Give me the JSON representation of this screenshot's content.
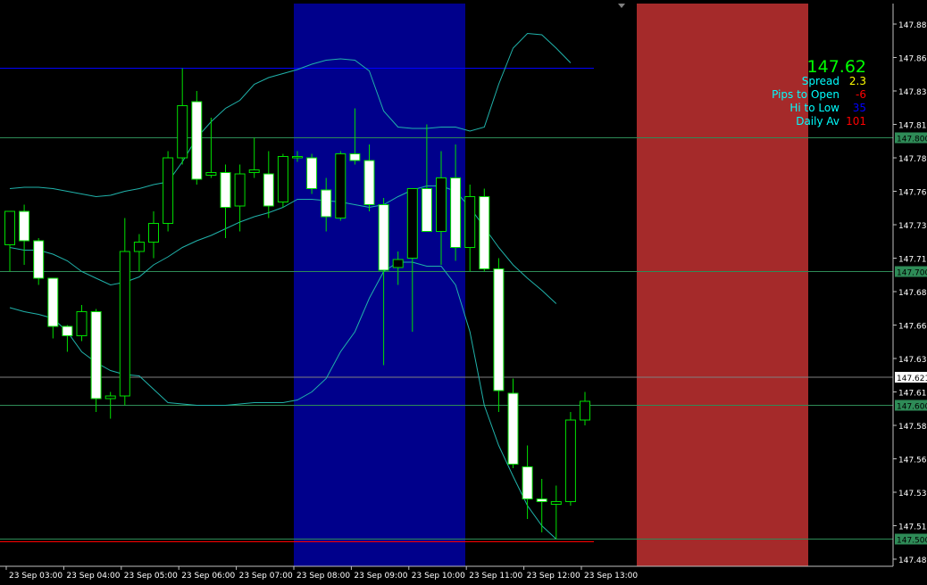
{
  "info": {
    "price": "147.62",
    "spread_label": "Spread",
    "spread_value": "2.3",
    "pips_label": "Pips to Open",
    "pips_value": "-6",
    "hilo_label": "Hi to Low",
    "hilo_value": "35",
    "daily_label": "Daily Av",
    "daily_value": "101"
  },
  "colors": {
    "background": "#000000",
    "bull_body": "#000000",
    "bear_body": "#ffffff",
    "candle_outline": "#00e000",
    "band": "#20b2aa",
    "session_blue": "#00008b",
    "session_red": "#a52a2a",
    "level_green": "#2e8b57",
    "level_blue": "#0000ff",
    "level_red": "#ff0000"
  },
  "chart_data": {
    "type": "candlestick",
    "ylim": [
      147.485,
      147.89
    ],
    "y_ticks": [
      "147.885",
      "147.860",
      "147.835",
      "147.810",
      "147.785",
      "147.760",
      "147.735",
      "147.710",
      "147.685",
      "147.660",
      "147.635",
      "147.610",
      "147.585",
      "147.560",
      "147.535",
      "147.510",
      "147.485"
    ],
    "y_tick_values": [
      147.885,
      147.86,
      147.835,
      147.81,
      147.785,
      147.76,
      147.735,
      147.71,
      147.685,
      147.66,
      147.635,
      147.61,
      147.585,
      147.56,
      147.535,
      147.51,
      147.485
    ],
    "x_tick_labels": [
      "23 Sep 03:00",
      "23 Sep 04:00",
      "23 Sep 05:00",
      "23 Sep 06:00",
      "23 Sep 07:00",
      "23 Sep 08:00",
      "23 Sep 09:00",
      "23 Sep 10:00",
      "23 Sep 11:00",
      "23 Sep 12:00",
      "23 Sep 13:00"
    ],
    "x_tick_index": [
      0,
      4,
      8,
      12,
      16,
      20,
      24,
      28,
      32,
      36,
      40
    ],
    "candles": [
      {
        "o": 147.72,
        "h": 147.74,
        "l": 147.7,
        "c": 147.745
      },
      {
        "o": 147.745,
        "h": 147.75,
        "l": 147.705,
        "c": 147.723
      },
      {
        "o": 147.723,
        "h": 147.725,
        "l": 147.69,
        "c": 147.695
      },
      {
        "o": 147.695,
        "h": 147.695,
        "l": 147.65,
        "c": 147.659
      },
      {
        "o": 147.659,
        "h": 147.66,
        "l": 147.64,
        "c": 147.652
      },
      {
        "o": 147.652,
        "h": 147.675,
        "l": 147.648,
        "c": 147.67
      },
      {
        "o": 147.67,
        "h": 147.672,
        "l": 147.595,
        "c": 147.605
      },
      {
        "o": 147.605,
        "h": 147.61,
        "l": 147.59,
        "c": 147.607
      },
      {
        "o": 147.607,
        "h": 147.74,
        "l": 147.6,
        "c": 147.715
      },
      {
        "o": 147.715,
        "h": 147.728,
        "l": 147.7,
        "c": 147.722
      },
      {
        "o": 147.722,
        "h": 147.745,
        "l": 147.71,
        "c": 147.736
      },
      {
        "o": 147.736,
        "h": 147.79,
        "l": 147.73,
        "c": 147.785
      },
      {
        "o": 147.785,
        "h": 147.852,
        "l": 147.78,
        "c": 147.824
      },
      {
        "o": 147.827,
        "h": 147.835,
        "l": 147.765,
        "c": 147.769
      },
      {
        "o": 147.772,
        "h": 147.815,
        "l": 147.77,
        "c": 147.774
      },
      {
        "o": 147.774,
        "h": 147.78,
        "l": 147.725,
        "c": 147.748
      },
      {
        "o": 147.749,
        "h": 147.78,
        "l": 147.73,
        "c": 147.773
      },
      {
        "o": 147.774,
        "h": 147.8,
        "l": 147.77,
        "c": 147.776
      },
      {
        "o": 147.773,
        "h": 147.79,
        "l": 147.74,
        "c": 147.749
      },
      {
        "o": 147.752,
        "h": 147.788,
        "l": 147.748,
        "c": 147.786
      },
      {
        "o": 147.785,
        "h": 147.79,
        "l": 147.782,
        "c": 147.786
      },
      {
        "o": 147.785,
        "h": 147.788,
        "l": 147.758,
        "c": 147.762
      },
      {
        "o": 147.761,
        "h": 147.77,
        "l": 147.73,
        "c": 147.741
      },
      {
        "o": 147.74,
        "h": 147.79,
        "l": 147.738,
        "c": 147.788
      },
      {
        "o": 147.788,
        "h": 147.822,
        "l": 147.78,
        "c": 147.783
      },
      {
        "o": 147.783,
        "h": 147.795,
        "l": 147.745,
        "c": 147.75
      },
      {
        "o": 147.75,
        "h": 147.755,
        "l": 147.63,
        "c": 147.701
      },
      {
        "o": 147.703,
        "h": 147.715,
        "l": 147.69,
        "c": 147.709
      },
      {
        "o": 147.71,
        "h": 147.74,
        "l": 147.655,
        "c": 147.762
      },
      {
        "o": 147.762,
        "h": 147.81,
        "l": 147.73,
        "c": 147.73
      },
      {
        "o": 147.73,
        "h": 147.79,
        "l": 147.705,
        "c": 147.77
      },
      {
        "o": 147.77,
        "h": 147.795,
        "l": 147.708,
        "c": 147.718
      },
      {
        "o": 147.718,
        "h": 147.765,
        "l": 147.7,
        "c": 147.756
      },
      {
        "o": 147.756,
        "h": 147.762,
        "l": 147.7,
        "c": 147.702
      },
      {
        "o": 147.702,
        "h": 147.71,
        "l": 147.595,
        "c": 147.611
      },
      {
        "o": 147.609,
        "h": 147.62,
        "l": 147.553,
        "c": 147.556
      },
      {
        "o": 147.554,
        "h": 147.57,
        "l": 147.515,
        "c": 147.53
      },
      {
        "o": 147.53,
        "h": 147.545,
        "l": 147.505,
        "c": 147.528
      },
      {
        "o": 147.526,
        "h": 147.54,
        "l": 147.5,
        "c": 147.528
      },
      {
        "o": 147.528,
        "h": 147.595,
        "l": 147.525,
        "c": 147.589
      },
      {
        "o": 147.589,
        "h": 147.61,
        "l": 147.585,
        "c": 147.603
      }
    ],
    "bands": {
      "upper": [
        147.762,
        147.763,
        147.763,
        147.762,
        147.76,
        147.758,
        147.756,
        147.757,
        147.76,
        147.762,
        147.765,
        147.767,
        147.782,
        147.8,
        147.812,
        147.822,
        147.828,
        147.84,
        147.845,
        147.848,
        147.851,
        147.855,
        147.858,
        147.859,
        147.858,
        147.85,
        147.82,
        147.808,
        147.807,
        147.807,
        147.808,
        147.808,
        147.805,
        147.808,
        147.84,
        147.867,
        147.878,
        147.877,
        147.867,
        147.856
      ],
      "middle": [
        147.718,
        147.716,
        147.716,
        147.713,
        147.708,
        147.7,
        147.695,
        147.69,
        147.692,
        147.696,
        147.705,
        147.711,
        147.718,
        147.723,
        147.727,
        147.732,
        147.737,
        147.741,
        147.744,
        147.748,
        147.754,
        147.754,
        147.753,
        147.752,
        147.75,
        147.748,
        147.75,
        147.756,
        147.761,
        147.764,
        147.764,
        147.76,
        147.748,
        147.733,
        147.718,
        147.705,
        147.695,
        147.686,
        147.676
      ],
      "lower": [
        147.673,
        147.67,
        147.668,
        147.665,
        147.655,
        147.64,
        147.632,
        147.626,
        147.623,
        147.622,
        147.612,
        147.602,
        147.601,
        147.6,
        147.6,
        147.6,
        147.601,
        147.602,
        147.602,
        147.602,
        147.604,
        147.61,
        147.62,
        147.64,
        147.655,
        147.68,
        147.7,
        147.707,
        147.707,
        147.704,
        147.704,
        147.69,
        147.655,
        147.6,
        147.57,
        147.547,
        147.525,
        147.51,
        147.5
      ]
    },
    "levels": [
      {
        "price": 147.8,
        "color": "green",
        "label": "147.800"
      },
      {
        "price": 147.7,
        "color": "green",
        "label": "147.700"
      },
      {
        "price": 147.6,
        "color": "green",
        "label": "147.600"
      },
      {
        "price": 147.5,
        "color": "green",
        "label": "147.500"
      },
      {
        "price": 147.621,
        "color": "white",
        "label": "147.621"
      },
      {
        "price": 147.852,
        "color": "blue",
        "label": ""
      },
      {
        "price": 147.498,
        "color": "red",
        "label": ""
      }
    ],
    "current_price": "147.621"
  }
}
